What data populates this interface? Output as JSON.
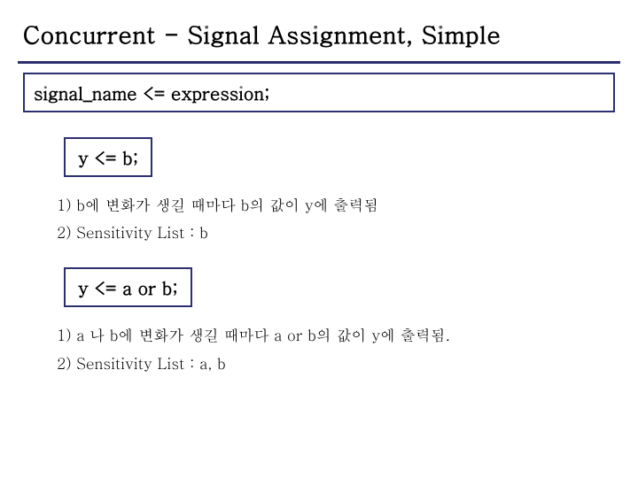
{
  "title": "Concurrent - Signal Assignment, Simple",
  "syntax": "signal_name <= expression;",
  "block1": {
    "code": "y <= b;",
    "note1": "1) b에 변화가 생길 때마다 b의 값이 y에 출력됨",
    "note2": "2) Sensitivity List : b"
  },
  "block2": {
    "code": "y <= a or b;",
    "note1": "1) a 나 b에 변화가 생길 때마다 a or b의 값이 y에 출력됨.",
    "note2": "2) Sensitivity List : a, b"
  }
}
